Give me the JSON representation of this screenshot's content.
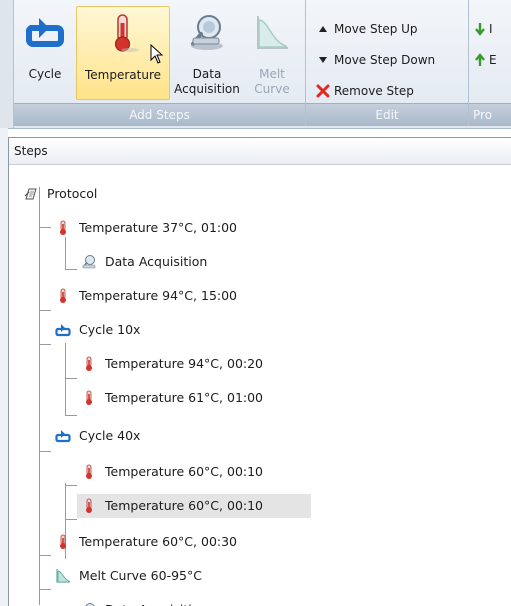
{
  "ribbon": {
    "add_steps": {
      "footer": "Add Steps",
      "cycle_label": "Cycle",
      "temperature_label": "Temperature",
      "data_acq_label": "Data\nAcquisition",
      "melt_label": "Melt\nCurve"
    },
    "edit": {
      "footer": "Edit",
      "move_up_label": "Move Step Up",
      "move_down_label": "Move Step Down",
      "remove_label": "Remove Step"
    },
    "pro": {
      "footer": "Pro",
      "item1_label": "I",
      "item2_label": "E"
    }
  },
  "steps_panel": {
    "header": "Steps",
    "items": [
      {
        "label": "Protocol",
        "icon": "protocol-icon"
      },
      {
        "label": "Temperature 37°C, 01:00",
        "icon": "thermometer-icon"
      },
      {
        "label": "Data Acquisition",
        "icon": "data-acquisition-icon"
      },
      {
        "label": "Temperature 94°C, 15:00",
        "icon": "thermometer-icon"
      },
      {
        "label": "Cycle 10x",
        "icon": "cycle-icon"
      },
      {
        "label": "Temperature 94°C, 00:20",
        "icon": "thermometer-icon"
      },
      {
        "label": "Temperature 61°C, 01:00",
        "icon": "thermometer-icon"
      },
      {
        "label": "Cycle 40x",
        "icon": "cycle-icon"
      },
      {
        "label": "Temperature 60°C, 00:10",
        "icon": "thermometer-icon"
      },
      {
        "label": "Temperature 60°C, 00:10",
        "icon": "thermometer-icon",
        "selected": true
      },
      {
        "label": "Temperature 60°C, 00:30",
        "icon": "thermometer-icon"
      },
      {
        "label": "Melt Curve 60-95°C",
        "icon": "melt-curve-icon"
      },
      {
        "label": "Data Acquisition",
        "icon": "data-acquisition-icon"
      }
    ]
  },
  "colors": {
    "cycle_blue": "#1d6fc9",
    "thermo_red": "#d0342c",
    "hover_yellow": "#ffe38a",
    "selected_row": "#e4e4e4",
    "remove_x": "#e02a1f",
    "arrow_green": "#3a9a2b",
    "arrow_orange": "#e07a12"
  }
}
